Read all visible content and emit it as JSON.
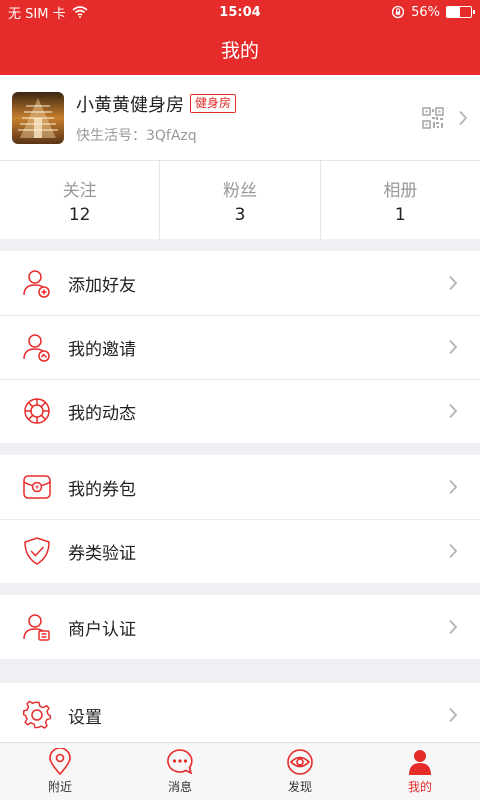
{
  "status": {
    "carrier": "无 SIM 卡",
    "time": "15:04",
    "battery": "56%",
    "battery_level": 0.56
  },
  "nav": {
    "title": "我的"
  },
  "profile": {
    "name": "小黄黄健身房",
    "tag": "健身房",
    "id_line": "快生活号：3QfAzq"
  },
  "stats": [
    {
      "label": "关注",
      "value": "12"
    },
    {
      "label": "粉丝",
      "value": "3"
    },
    {
      "label": "相册",
      "value": "1"
    }
  ],
  "menu": {
    "add_friend": "添加好友",
    "invite": "我的邀请",
    "moments": "我的动态",
    "coupons": "我的券包",
    "verify": "券类验证",
    "merchant": "商户认证",
    "settings": "设置"
  },
  "tabs": [
    {
      "label": "附近",
      "icon": "location-pin-icon"
    },
    {
      "label": "消息",
      "icon": "message-bubble-icon"
    },
    {
      "label": "发现",
      "icon": "eye-icon"
    },
    {
      "label": "我的",
      "icon": "person-icon"
    }
  ],
  "colors": {
    "accent": "#e62b2b",
    "background": "#efeff4"
  }
}
